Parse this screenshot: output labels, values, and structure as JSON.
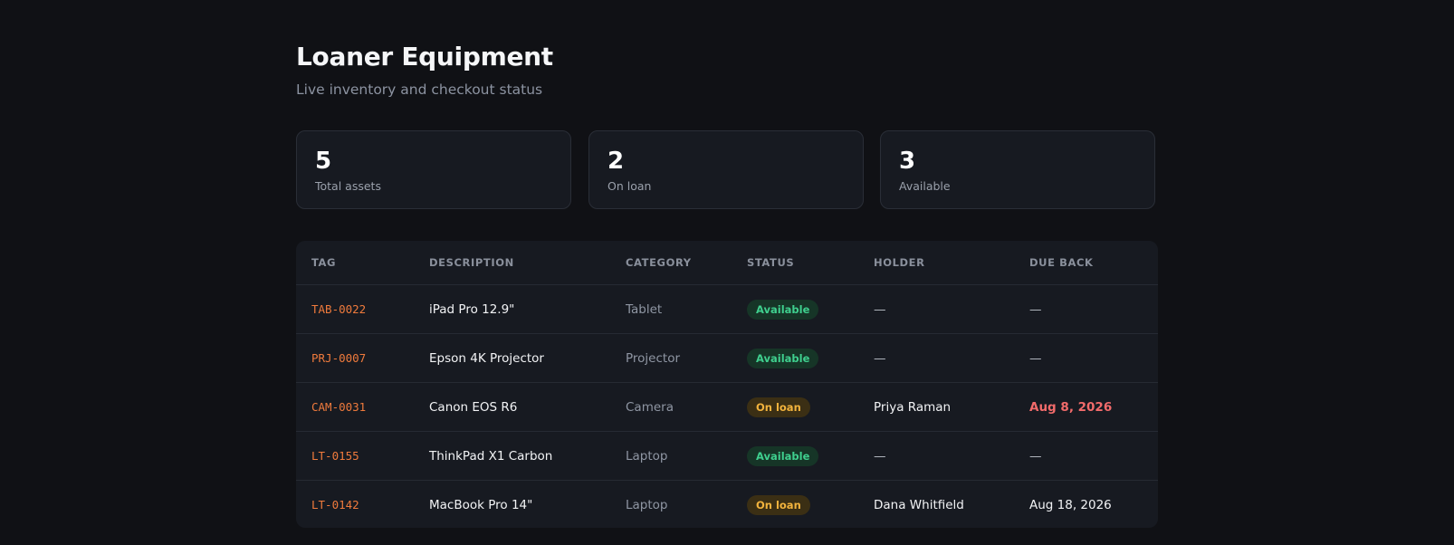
{
  "header": {
    "title": "Loaner Equipment",
    "subtitle": "Live inventory and checkout status"
  },
  "stats": [
    {
      "value": "5",
      "label": "Total assets"
    },
    {
      "value": "2",
      "label": "On loan"
    },
    {
      "value": "3",
      "label": "Available"
    }
  ],
  "table": {
    "columns": [
      "TAG",
      "DESCRIPTION",
      "CATEGORY",
      "STATUS",
      "HOLDER",
      "DUE BACK"
    ],
    "rows": [
      {
        "tag": "TAB-0022",
        "description": "iPad Pro 12.9\"",
        "category": "Tablet",
        "status": "Available",
        "holder": "—",
        "due": "—"
      },
      {
        "tag": "PRJ-0007",
        "description": "Epson 4K Projector",
        "category": "Projector",
        "status": "Available",
        "holder": "—",
        "due": "—"
      },
      {
        "tag": "CAM-0031",
        "description": "Canon EOS R6",
        "category": "Camera",
        "status": "On loan",
        "holder": "Priya Raman",
        "due": "Aug 8, 2026"
      },
      {
        "tag": "LT-0155",
        "description": "ThinkPad X1 Carbon",
        "category": "Laptop",
        "status": "Available",
        "holder": "—",
        "due": "—"
      },
      {
        "tag": "LT-0142",
        "description": "MacBook Pro 14\"",
        "category": "Laptop",
        "status": "On loan",
        "holder": "Dana Whitfield",
        "due": "Aug 18, 2026"
      }
    ]
  },
  "colors": {
    "background": "#101115",
    "card": "#171a21",
    "tag_accent": "#ef7a3c",
    "available": "#3fcf8e",
    "on_loan": "#f2b33d",
    "overdue": "#f26b6b"
  }
}
